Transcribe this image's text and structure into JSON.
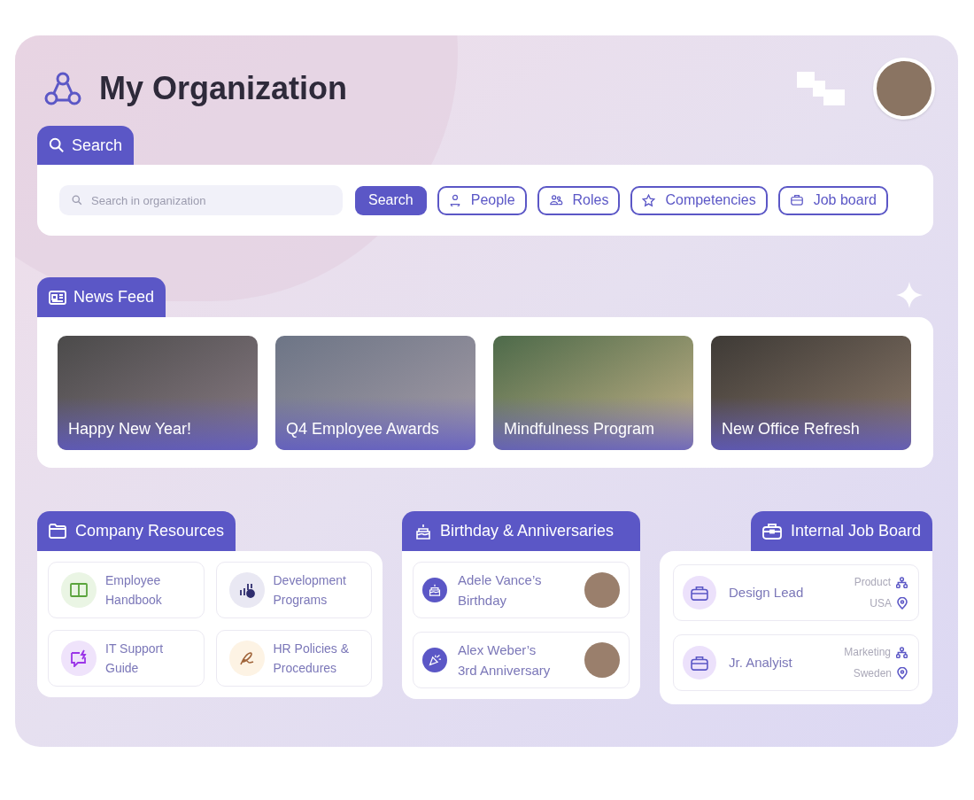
{
  "header": {
    "title": "My Organization"
  },
  "search": {
    "tab": "Search",
    "placeholder": "Search in organization",
    "buttons": [
      {
        "label": "Search",
        "kind": "primary"
      },
      {
        "label": "People",
        "kind": "people"
      },
      {
        "label": "Roles",
        "kind": "roles"
      },
      {
        "label": "Competencies",
        "kind": "competencies"
      },
      {
        "label": "Job board",
        "kind": "jobs"
      }
    ]
  },
  "news_feed": {
    "tab": "News Feed",
    "items": [
      {
        "caption": "Happy New Year!"
      },
      {
        "caption": "Q4 Employee Awards"
      },
      {
        "caption": "Mindfulness Program"
      },
      {
        "caption": "New Office Refresh"
      }
    ]
  },
  "company_resources": {
    "tab": "Company Resources",
    "items": [
      {
        "label": "Employee Handbook",
        "kind": "handbook",
        "color": "#eaf5e4"
      },
      {
        "label": "Development Programs",
        "kind": "development",
        "color": "#e9e8f3"
      },
      {
        "label": "IT Support Guide",
        "kind": "support",
        "color": "#efe3fb"
      },
      {
        "label": "HR Policies & Procedures",
        "kind": "policies",
        "color": "#fdf3e4"
      }
    ]
  },
  "birthdays": {
    "tab": "Birthday & Anniversaries",
    "items": [
      {
        "line_1": "Adele Vance’s",
        "line_2": "Birthday",
        "kind": "birthday"
      },
      {
        "line_1": "Alex Weber’s",
        "line_2": "3rd Anniversary",
        "kind": "anniversary"
      }
    ]
  },
  "job_board": {
    "tab": "Internal Job Board",
    "items": [
      {
        "title": "Design Lead",
        "department": "Product",
        "location": "USA"
      },
      {
        "title": "Jr. Analyist",
        "department": "Marketing",
        "location": "Sweden"
      }
    ]
  }
}
